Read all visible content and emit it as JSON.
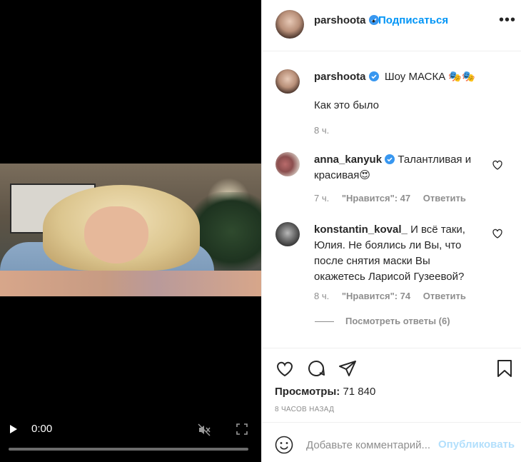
{
  "video": {
    "time": "0:00"
  },
  "header": {
    "username": "parshoota",
    "dot": "•",
    "follow_label": "Подписаться",
    "more": "•••"
  },
  "post": {
    "username": "parshoota",
    "caption_line1": "Шоу МАСКА 🎭🎭",
    "caption_line2": "Как это было",
    "ago": "8 ч."
  },
  "comments": [
    {
      "username": "anna_kanyuk",
      "text": "Талантливая и красивая😍",
      "ago": "7 ч.",
      "likes": "\"Нравится\": 47",
      "reply_label": "Ответить"
    },
    {
      "username": "konstantin_koval_",
      "text": "И всё таки, Юлия. Не боялись ли Вы, что после снятия маски Вы окажетесь Ларисой Гузеевой?",
      "ago": "8 ч.",
      "likes": "\"Нравится\": 74",
      "reply_label": "Ответить",
      "view_replies": "Посмотреть ответы (6)"
    }
  ],
  "actions": {
    "views_label": "Просмотры:",
    "views_value": "71 840",
    "time_ago": "8 ЧАСОВ НАЗАД"
  },
  "add_comment": {
    "placeholder": "Добавьте комментарий...",
    "publish_label": "Опубликовать"
  },
  "colors": {
    "accent": "#0095f6",
    "publish_disabled": "#b2dffc",
    "muted": "#8e8e8e",
    "verified": "#3897f0"
  },
  "icons": [
    "play-icon",
    "mute-icon",
    "fullscreen-icon",
    "verified-icon",
    "heart-icon",
    "comment-icon",
    "share-icon",
    "bookmark-icon",
    "emoji-icon",
    "more-icon"
  ]
}
